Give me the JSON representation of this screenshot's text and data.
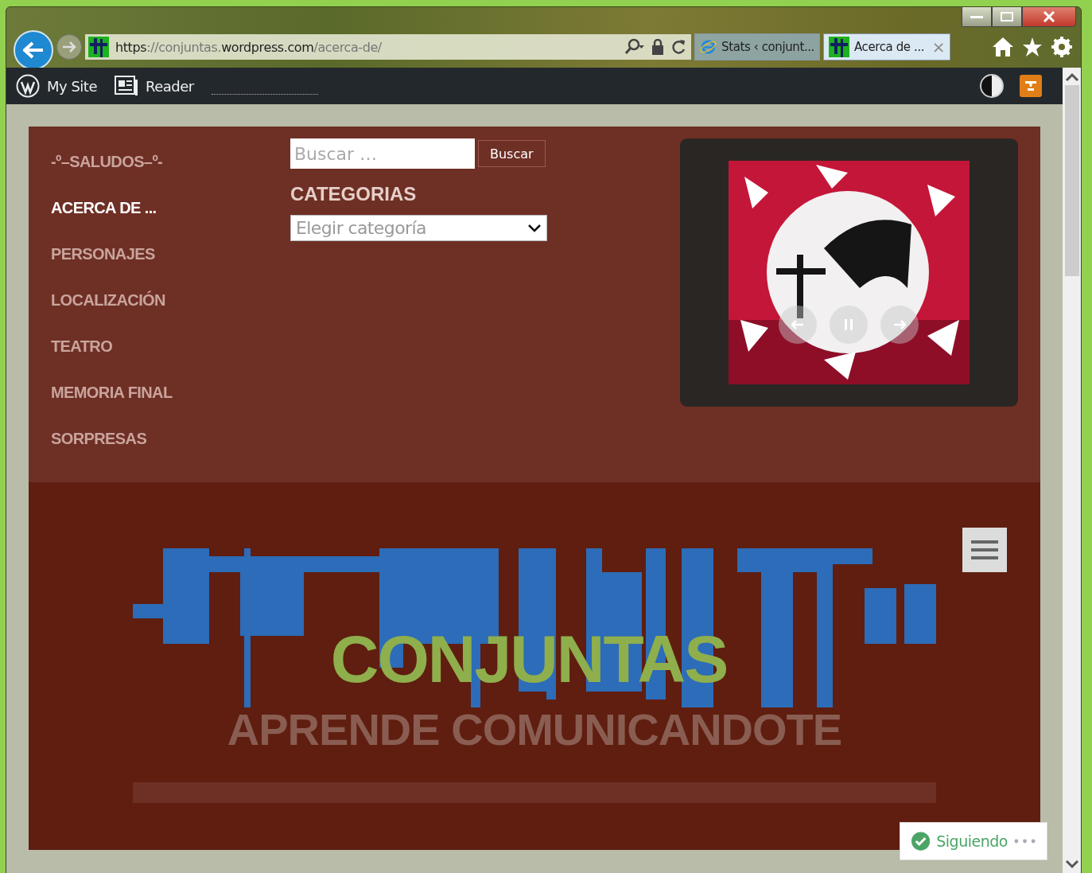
{
  "browser": {
    "address": "**https**://conjuntas.**wordpress.com**/acerca-de/",
    "tabs": [
      {
        "title": "Stats ‹ conjunt...",
        "selected": false,
        "kind": "ie"
      },
      {
        "title": "Acerca de ...",
        "selected": true,
        "kind": "site",
        "close": "×"
      }
    ]
  },
  "admin_bar": {
    "items": [
      {
        "label": "My Site",
        "kind": "wordpress"
      },
      {
        "label": "Reader",
        "kind": "reader"
      }
    ]
  },
  "menu": {
    "items": [
      {
        "label": "-º–SALUDOS–º-",
        "selected": false
      },
      {
        "label": "ACERCA DE ...",
        "selected": true
      },
      {
        "label": "PERSONAJES",
        "selected": false
      },
      {
        "label": "LOCALIZACIÓN",
        "selected": false
      },
      {
        "label": "TEATRO",
        "selected": false
      },
      {
        "label": "MEMORIA FINAL",
        "selected": false
      },
      {
        "label": "SORPRESAS",
        "selected": false
      }
    ]
  },
  "search": {
    "placeholder": "Buscar …",
    "button": "Buscar"
  },
  "categories": {
    "heading": "CATEGORIAS",
    "value": "Elegir categoría"
  },
  "header": {
    "title": "CONJUNTAS",
    "tagline": "APRENDE COMUNICANDOTE"
  },
  "follow": {
    "label": "Siguiendo"
  }
}
